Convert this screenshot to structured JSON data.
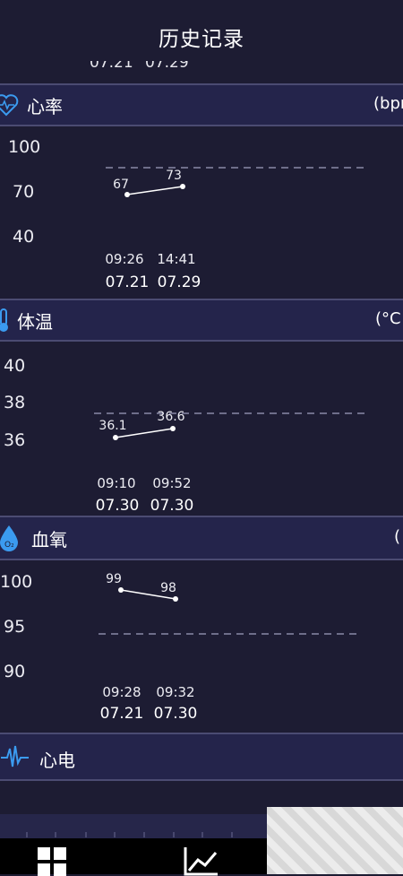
{
  "header": {
    "title": "历史记录",
    "partial_dates": [
      "07.21",
      "07.29"
    ]
  },
  "sections": {
    "heart_rate": {
      "label": "心率",
      "unit": "(bpm",
      "y_ticks": [
        "100",
        "70",
        "40"
      ],
      "points": [
        {
          "value": "67",
          "time": "09:26",
          "date": "07.21"
        },
        {
          "value": "73",
          "time": "14:41",
          "date": "07.29"
        }
      ]
    },
    "temperature": {
      "label": "体温",
      "unit": "(°C",
      "y_ticks": [
        "40",
        "38",
        "36"
      ],
      "points": [
        {
          "value": "36.1",
          "time": "09:10",
          "date": "07.30"
        },
        {
          "value": "36.6",
          "time": "09:52",
          "date": "07.30"
        }
      ]
    },
    "blood_oxygen": {
      "label": "血氧",
      "unit": "(",
      "y_ticks": [
        "100",
        "95",
        "90"
      ],
      "points": [
        {
          "value": "99",
          "time": "09:28",
          "date": "07.21"
        },
        {
          "value": "98",
          "time": "09:32",
          "date": "07.30"
        }
      ]
    },
    "ecg": {
      "label": "心电"
    }
  },
  "colors": {
    "background": "#1d1c33",
    "header_band": "#24244b",
    "accent_blue": "#3b9bf0"
  }
}
